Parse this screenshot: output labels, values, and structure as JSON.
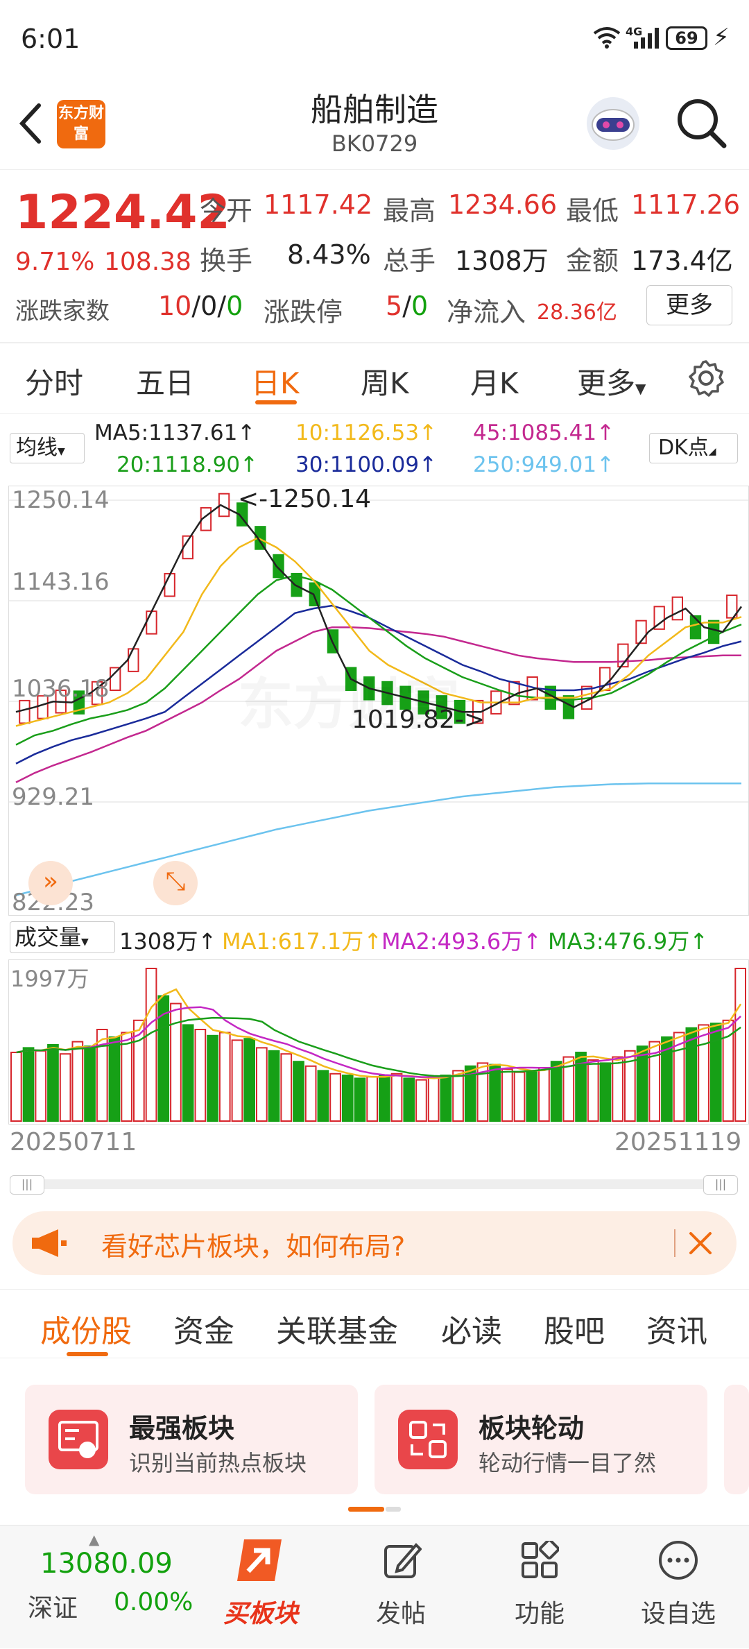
{
  "status": {
    "time": "6:01",
    "network": "4G",
    "battery": "69"
  },
  "header": {
    "title": "船舶制造",
    "code": "BK0729",
    "logo_text": "东方财富"
  },
  "quote": {
    "price": "1224.42",
    "change_pct": "9.71%",
    "change": "108.38",
    "open_label": "今开",
    "open": "1117.42",
    "high_label": "最高",
    "high": "1234.66",
    "low_label": "最低",
    "low": "1117.26",
    "turnover_label": "换手",
    "turnover": "8.43%",
    "volume_label": "总手",
    "volume": "1308万",
    "amount_label": "金额",
    "amount": "173.4亿",
    "breadth_label": "涨跌家数",
    "breadth_up": "10",
    "breadth_flat": "0",
    "breadth_down": "0",
    "limit_label": "涨跌停",
    "limit_up": "5",
    "limit_down": "0",
    "netflow_label": "净流入",
    "netflow": "28.36亿",
    "more_label": "更多"
  },
  "tabs": [
    "分时",
    "五日",
    "日K",
    "周K",
    "月K",
    "更多"
  ],
  "ma": {
    "selector": "均线",
    "dk": "DK点",
    "ma5": "MA5:1137.61↑",
    "ma10": "10:1126.53↑",
    "ma45": "45:1085.41↑",
    "ma20": "20:1118.90↑",
    "ma30": "30:1100.09↑",
    "ma250": "250:949.01↑"
  },
  "chart_data": {
    "type": "line",
    "y_labels": [
      "1250.14",
      "1143.16",
      "1036.18",
      "929.21",
      "822.23"
    ],
    "ylim": [
      822.23,
      1250.14
    ],
    "annotations": [
      "<-1250.14",
      "1019.82->"
    ],
    "watermark": "东方财富",
    "colors": {
      "ma5": "#222222",
      "ma10": "#f2b91b",
      "ma20": "#1a9e1a",
      "ma30": "#1a2b9a",
      "ma45": "#c3288f",
      "ma250": "#6cc3ee",
      "up": "#d7262c",
      "down": "#16a016"
    },
    "ma5": [
      1025,
      1030,
      1036,
      1035,
      1045,
      1060,
      1080,
      1120,
      1160,
      1200,
      1230,
      1245,
      1235,
      1210,
      1180,
      1160,
      1150,
      1100,
      1060,
      1050,
      1045,
      1040,
      1035,
      1030,
      1025,
      1025,
      1035,
      1045,
      1050,
      1040,
      1030,
      1040,
      1060,
      1085,
      1110,
      1125,
      1135,
      1115,
      1110,
      1137
    ],
    "ma10": [
      1010,
      1015,
      1020,
      1025,
      1030,
      1035,
      1045,
      1060,
      1085,
      1110,
      1150,
      1180,
      1200,
      1210,
      1200,
      1185,
      1165,
      1140,
      1115,
      1090,
      1075,
      1065,
      1055,
      1045,
      1040,
      1035,
      1035,
      1035,
      1040,
      1040,
      1040,
      1045,
      1050,
      1065,
      1085,
      1100,
      1115,
      1120,
      1120,
      1126
    ],
    "ma20": [
      990,
      1000,
      1005,
      1012,
      1018,
      1022,
      1027,
      1035,
      1050,
      1070,
      1090,
      1110,
      1130,
      1150,
      1165,
      1170,
      1165,
      1155,
      1140,
      1125,
      1110,
      1095,
      1082,
      1072,
      1062,
      1055,
      1048,
      1042,
      1040,
      1038,
      1038,
      1040,
      1045,
      1055,
      1065,
      1078,
      1090,
      1100,
      1110,
      1118
    ],
    "ma30": [
      970,
      980,
      988,
      995,
      1000,
      1006,
      1012,
      1018,
      1025,
      1040,
      1055,
      1070,
      1085,
      1100,
      1115,
      1130,
      1135,
      1138,
      1132,
      1125,
      1115,
      1105,
      1095,
      1085,
      1075,
      1068,
      1060,
      1055,
      1050,
      1048,
      1048,
      1050,
      1055,
      1060,
      1068,
      1075,
      1082,
      1088,
      1095,
      1100
    ],
    "ma45": [
      950,
      960,
      968,
      975,
      982,
      990,
      998,
      1005,
      1015,
      1025,
      1035,
      1048,
      1060,
      1075,
      1090,
      1100,
      1110,
      1115,
      1115,
      1114,
      1112,
      1110,
      1108,
      1105,
      1100,
      1095,
      1090,
      1085,
      1082,
      1080,
      1078,
      1078,
      1078,
      1079,
      1080,
      1082,
      1083,
      1084,
      1085,
      1085
    ],
    "ma250": [
      830,
      835,
      840,
      845,
      850,
      855,
      860,
      865,
      870,
      875,
      880,
      885,
      890,
      895,
      900,
      904,
      908,
      912,
      916,
      920,
      923,
      926,
      929,
      932,
      935,
      937,
      939,
      941,
      943,
      945,
      946,
      947,
      948,
      948.5,
      949,
      949,
      949,
      949,
      949,
      949.01
    ]
  },
  "volume": {
    "selector": "成交量",
    "total": "1308万↑",
    "ma1": "MA1:617.1万↑",
    "ma2": "MA2:493.6万↑",
    "ma3": "MA3:476.9万↑",
    "max_label": "1997万",
    "date_start": "20250711",
    "date_end": "20251119",
    "bars": [
      45,
      48,
      46,
      50,
      44,
      52,
      49,
      60,
      55,
      58,
      66,
      100,
      82,
      77,
      63,
      60,
      56,
      58,
      53,
      54,
      48,
      46,
      44,
      39,
      36,
      33,
      31,
      30,
      28,
      29,
      30,
      31,
      28,
      27,
      29,
      30,
      33,
      36,
      38,
      37,
      34,
      32,
      33,
      35,
      39,
      42,
      45,
      40,
      38,
      42,
      46,
      49,
      52,
      55,
      58,
      61,
      63,
      64,
      66,
      100
    ],
    "bar_up": [
      1,
      0,
      1,
      0,
      1,
      1,
      0,
      1,
      0,
      1,
      1,
      1,
      0,
      1,
      0,
      1,
      0,
      1,
      1,
      0,
      1,
      0,
      1,
      0,
      1,
      0,
      1,
      0,
      0,
      1,
      0,
      1,
      0,
      1,
      1,
      0,
      1,
      0,
      1,
      0,
      1,
      1,
      0,
      1,
      0,
      1,
      0,
      1,
      0,
      1,
      1,
      0,
      1,
      0,
      1,
      0,
      1,
      0,
      1,
      1
    ]
  },
  "banner": {
    "text": "看好芯片板块，如何布局?"
  },
  "subtabs": [
    "成份股",
    "资金",
    "关联基金",
    "必读",
    "股吧",
    "资讯"
  ],
  "cards": [
    {
      "title": "最强板块",
      "sub": "识别当前热点板块"
    },
    {
      "title": "板块轮动",
      "sub": "轮动行情一目了然"
    }
  ],
  "bottom": {
    "index_value": "13080.09",
    "index_name": "深证",
    "index_change": "0.00%",
    "buy_label": "买板块",
    "post_label": "发帖",
    "func_label": "功能",
    "watch_label": "设自选"
  }
}
